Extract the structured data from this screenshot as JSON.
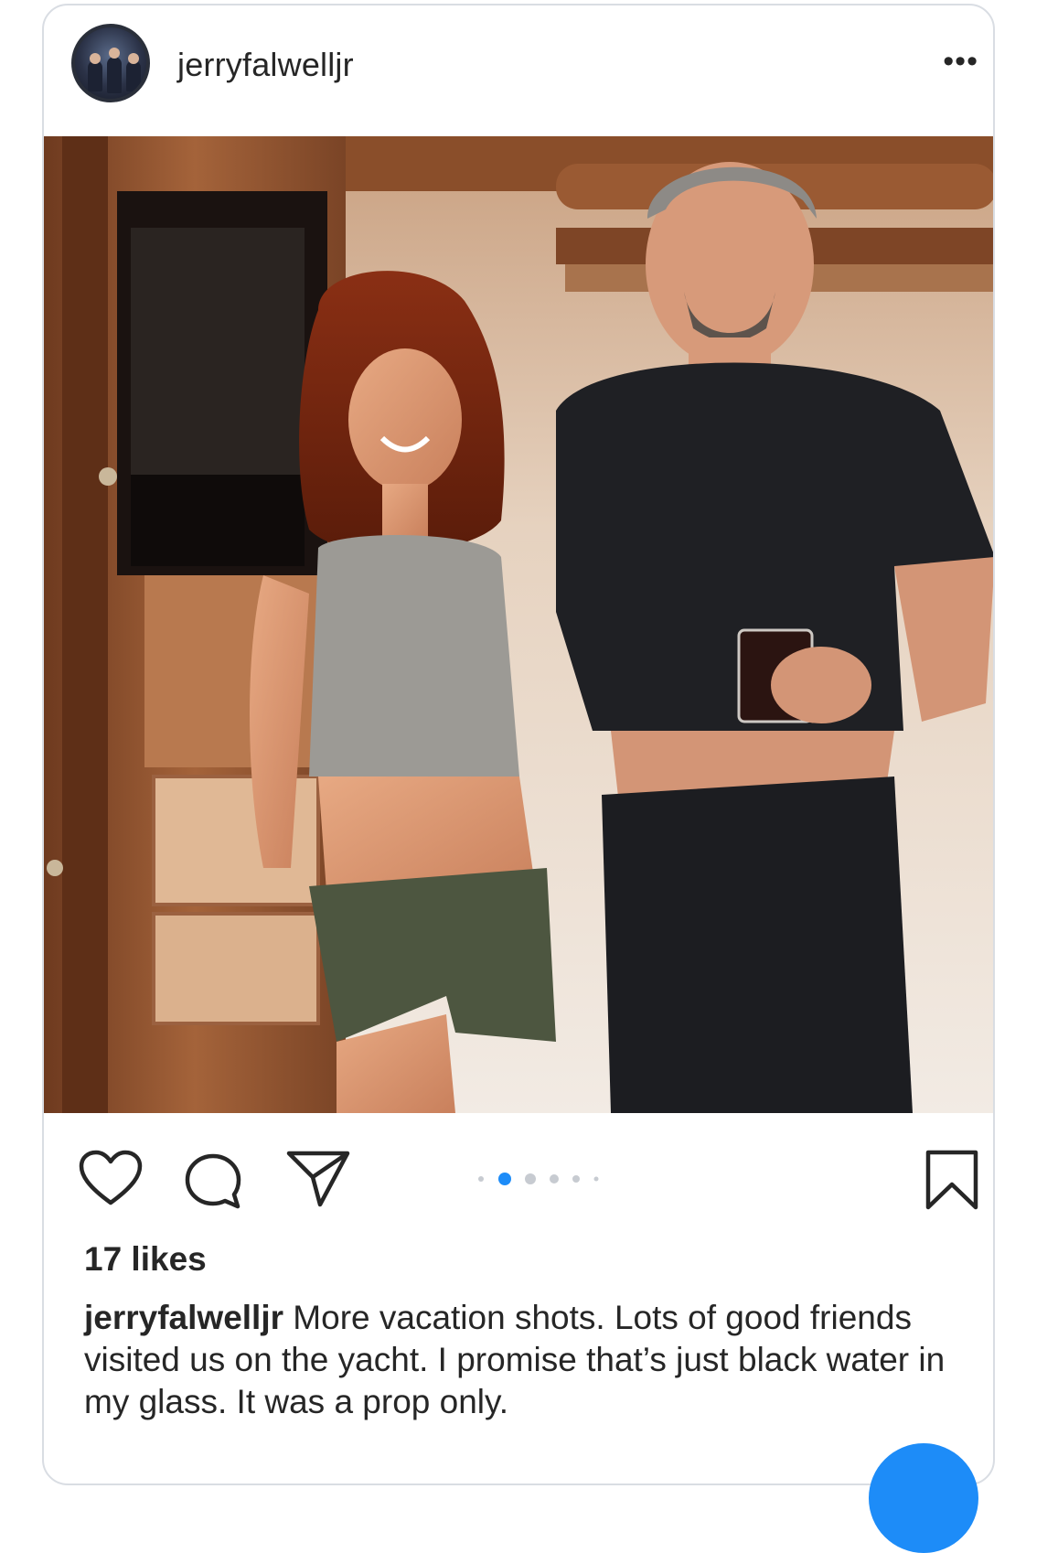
{
  "post": {
    "username": "jerryfalwelljr",
    "more_icon": "more-horizontal-icon",
    "likes": "17 likes",
    "caption_user": "jerryfalwelljr",
    "caption_text": "More vacation shots.  Lots of good friends visited us on the yacht.  I promise that’s just black water in my glass.  It was a prop only.",
    "carousel": {
      "count": 6,
      "active_index": 1
    },
    "actions": [
      "heart-icon",
      "comment-icon",
      "share-icon",
      "bookmark-icon"
    ]
  },
  "colors": {
    "text": "#262626",
    "accent_dot": "#1d8cf8",
    "inactive_dot": "#c7cbd1",
    "card_border": "#d9dde3"
  }
}
